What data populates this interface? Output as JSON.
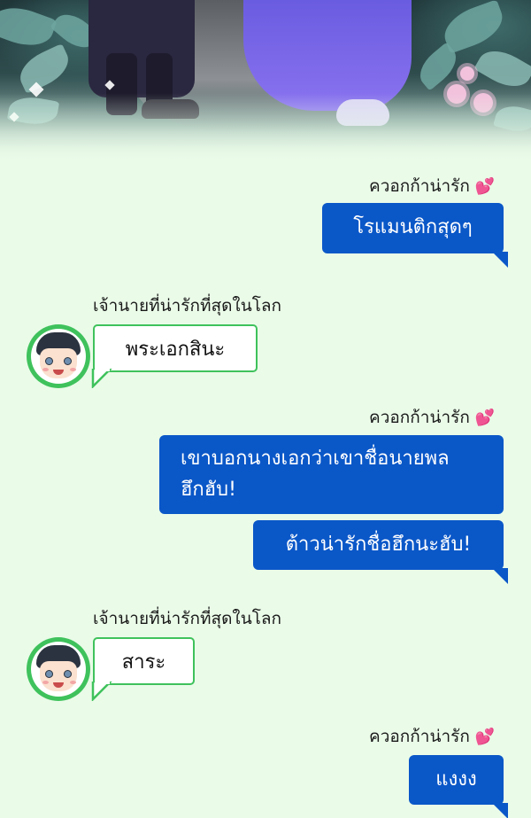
{
  "chat": {
    "sender_me": "ควอกก้าน่ารัก",
    "sender_boss": "เจ้านายที่น่ารักที่สุดในโลก",
    "messages": [
      {
        "from": "me",
        "text": "โรแมนติกสุดๆ"
      },
      {
        "from": "boss",
        "text": "พระเอกสินะ"
      },
      {
        "from": "me",
        "text": "เขาบอกนางเอกว่าเขาชื่อนายพล ฮึกฮับ!"
      },
      {
        "from": "me",
        "text": "ต้าวน่ารักชื่อฮึกนะฮับ!"
      },
      {
        "from": "boss",
        "text": "สาระ"
      },
      {
        "from": "me",
        "text": "แงงง"
      }
    ]
  },
  "icons": {
    "heart": "heart-icon",
    "avatar": "boss-avatar"
  },
  "colors": {
    "background": "#eafbe8",
    "me_bubble": "#0a57c8",
    "boss_border": "#3fc25c",
    "heart": "#ef4d8b"
  }
}
